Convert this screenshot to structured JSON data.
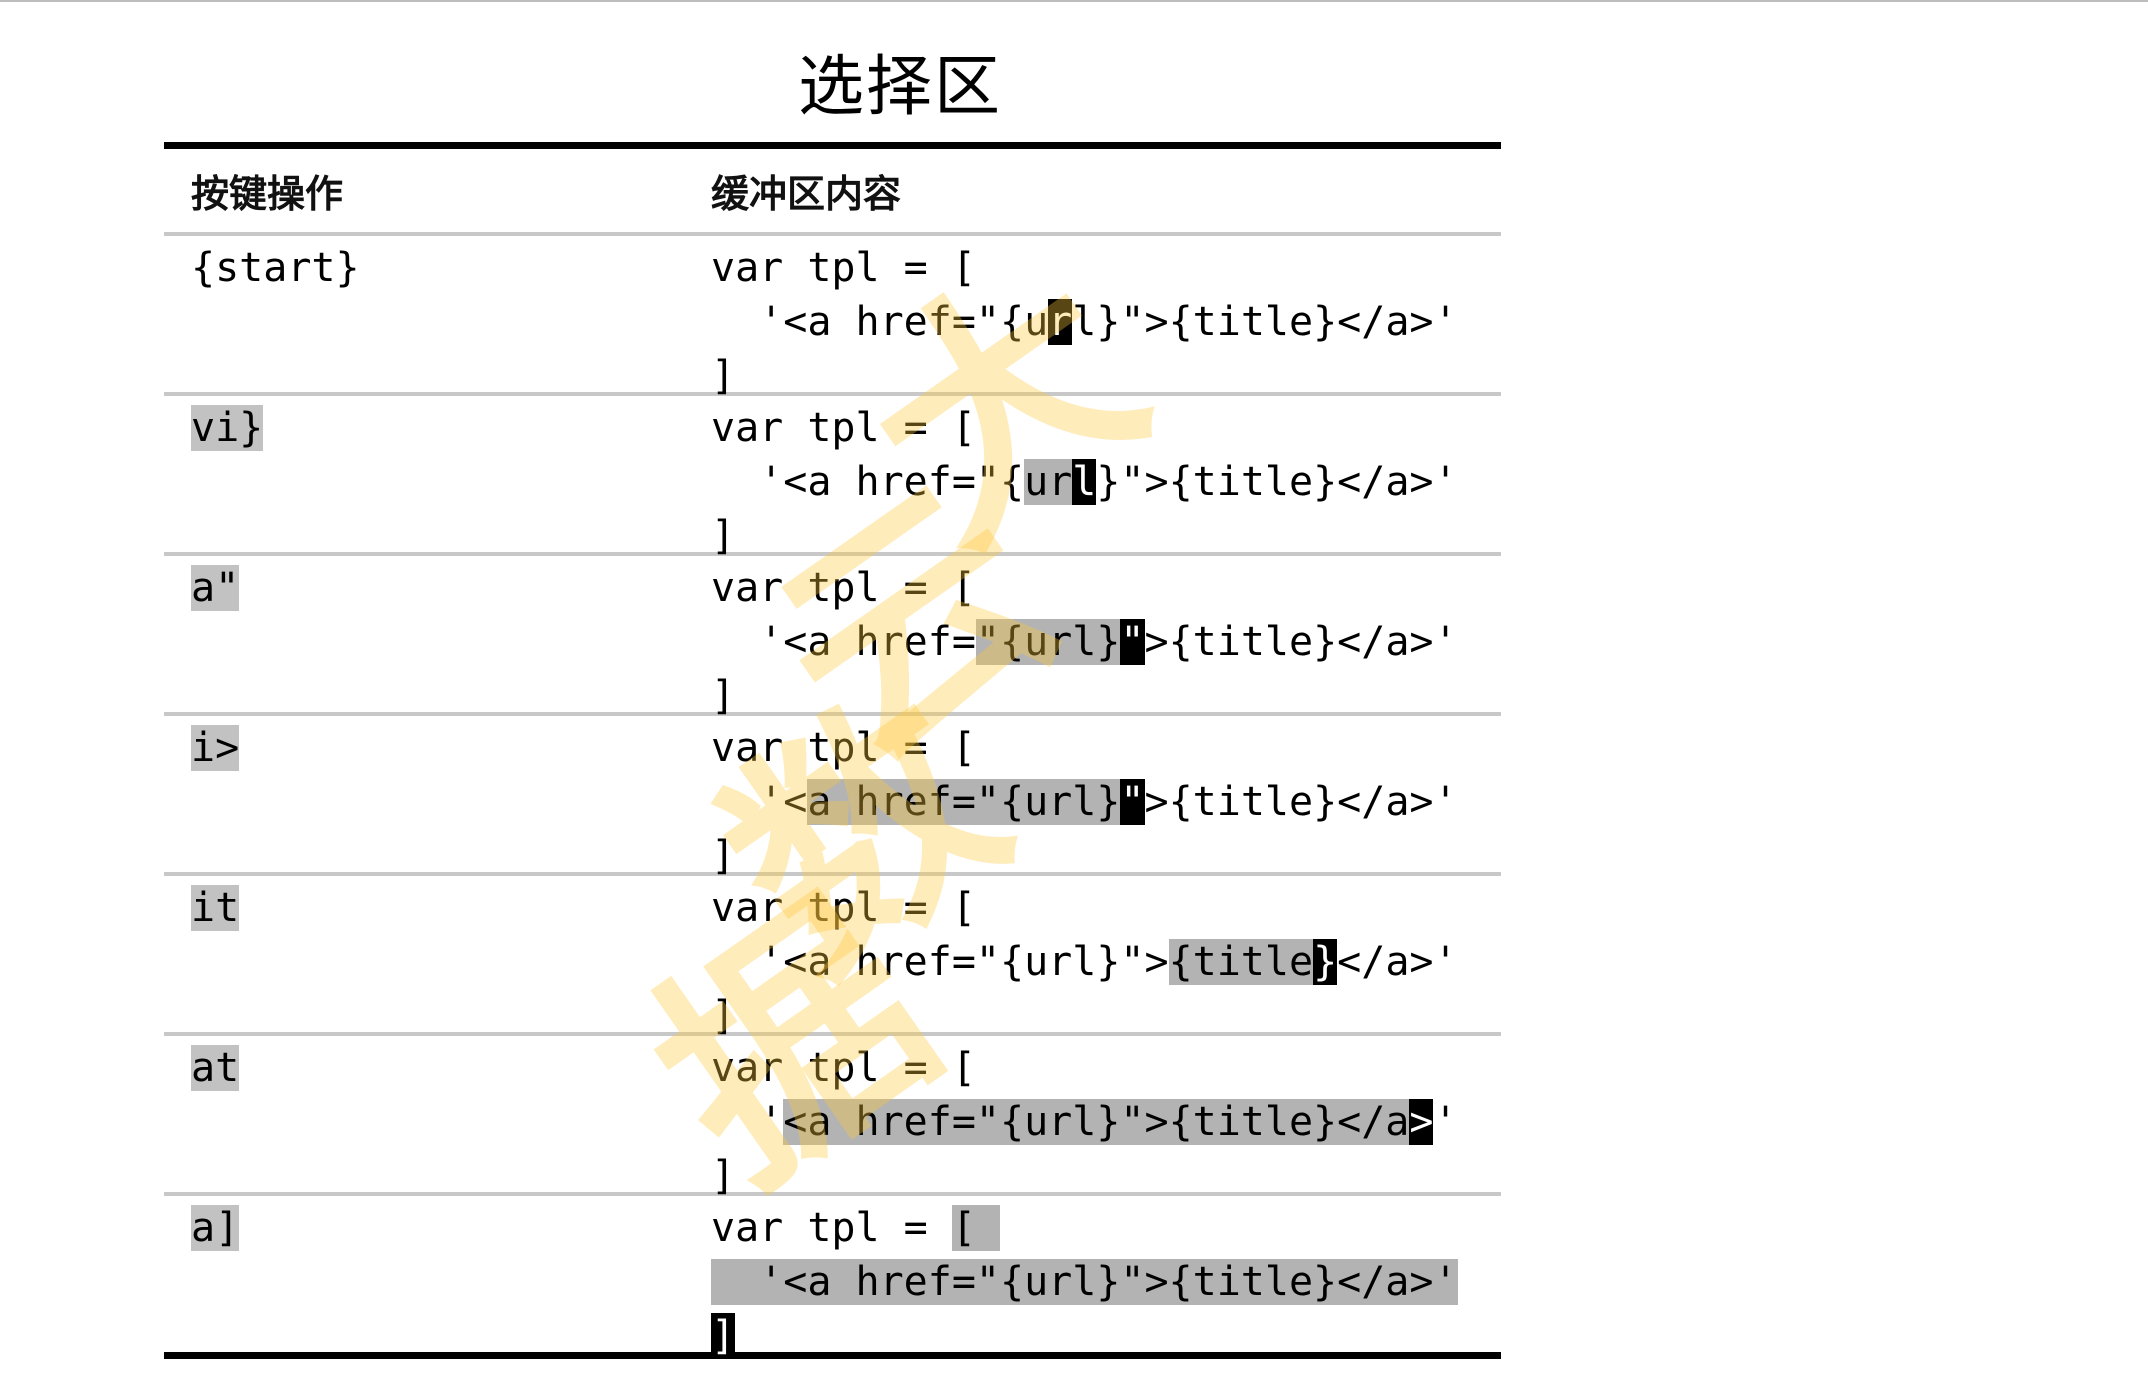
{
  "title": "选择区",
  "table": {
    "headers": {
      "key": "按键操作",
      "buffer": "缓冲区内容"
    },
    "rows": [
      {
        "key": [
          {
            "t": "{start}"
          }
        ],
        "buffer": [
          [
            {
              "t": "var tpl = ["
            }
          ],
          [
            {
              "t": "  '<a href=\"{u"
            },
            {
              "t": "r",
              "c": "cur"
            },
            {
              "t": "l}\">{title}</a>'"
            }
          ],
          [
            {
              "t": "]"
            }
          ]
        ]
      },
      {
        "key": [
          {
            "t": "vi}",
            "c": "key-sel"
          }
        ],
        "buffer": [
          [
            {
              "t": "var tpl = ["
            }
          ],
          [
            {
              "t": "  '<a href=\"{"
            },
            {
              "t": "ur",
              "c": "sel"
            },
            {
              "t": "l",
              "c": "cur"
            },
            {
              "t": "}\">{title}</a>'"
            }
          ],
          [
            {
              "t": "]"
            }
          ]
        ]
      },
      {
        "key": [
          {
            "t": "a\"",
            "c": "key-sel"
          }
        ],
        "buffer": [
          [
            {
              "t": "var tpl = ["
            }
          ],
          [
            {
              "t": "  '<a href="
            },
            {
              "t": "\"{url}",
              "c": "sel"
            },
            {
              "t": "\"",
              "c": "cur"
            },
            {
              "t": ">{title}</a>'"
            }
          ],
          [
            {
              "t": "]"
            }
          ]
        ]
      },
      {
        "key": [
          {
            "t": "i>",
            "c": "key-sel"
          }
        ],
        "buffer": [
          [
            {
              "t": "var tpl = ["
            }
          ],
          [
            {
              "t": "  '<"
            },
            {
              "t": "a href=\"{url}",
              "c": "sel"
            },
            {
              "t": "\"",
              "c": "cur"
            },
            {
              "t": ">{title}</a>'"
            }
          ],
          [
            {
              "t": "]"
            }
          ]
        ]
      },
      {
        "key": [
          {
            "t": "it",
            "c": "key-sel"
          }
        ],
        "buffer": [
          [
            {
              "t": "var tpl = ["
            }
          ],
          [
            {
              "t": "  '<a href=\"{url}\">"
            },
            {
              "t": "{title",
              "c": "sel"
            },
            {
              "t": "}",
              "c": "cur"
            },
            {
              "t": "</a>'"
            }
          ],
          [
            {
              "t": "]"
            }
          ]
        ]
      },
      {
        "key": [
          {
            "t": "at",
            "c": "key-sel"
          }
        ],
        "buffer": [
          [
            {
              "t": "var tpl = ["
            }
          ],
          [
            {
              "t": "  '"
            },
            {
              "t": "<a href=\"{url}\">{title}</a",
              "c": "sel"
            },
            {
              "t": ">",
              "c": "cur"
            },
            {
              "t": "'"
            }
          ],
          [
            {
              "t": "]"
            }
          ]
        ]
      },
      {
        "key": [
          {
            "t": "a]",
            "c": "key-sel"
          }
        ],
        "buffer": [
          [
            {
              "t": "var tpl = "
            },
            {
              "t": "[ ",
              "c": "sel"
            }
          ],
          [
            {
              "t": "  '<a href=\"{url}\">{title}</a>'",
              "c": "sel"
            }
          ],
          [
            {
              "t": "]",
              "c": "cur"
            }
          ]
        ]
      }
    ]
  },
  "watermark": {
    "chars": [
      "大",
      "云",
      "数",
      "据"
    ],
    "color": "#ffc83c"
  }
}
